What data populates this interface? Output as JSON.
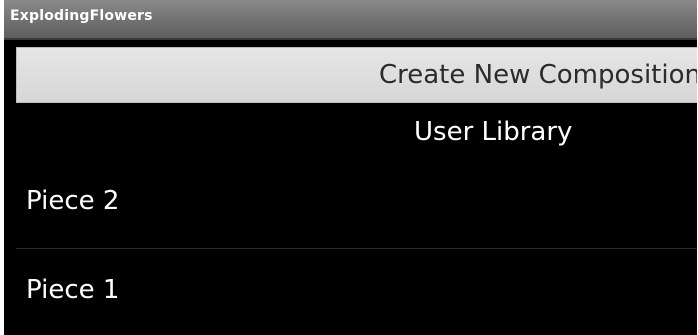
{
  "app": {
    "title": "ExplodingFlowers"
  },
  "actions": {
    "create_label": "Create New Composition"
  },
  "library": {
    "header": "User Library",
    "items": [
      {
        "label": "Piece 2"
      },
      {
        "label": "Piece 1"
      }
    ]
  },
  "colors": {
    "background": "#000000",
    "title_bar": "#6f6f6f",
    "button_bg": "#dedede",
    "button_text": "#2b2b2b",
    "text": "#ffffff"
  }
}
